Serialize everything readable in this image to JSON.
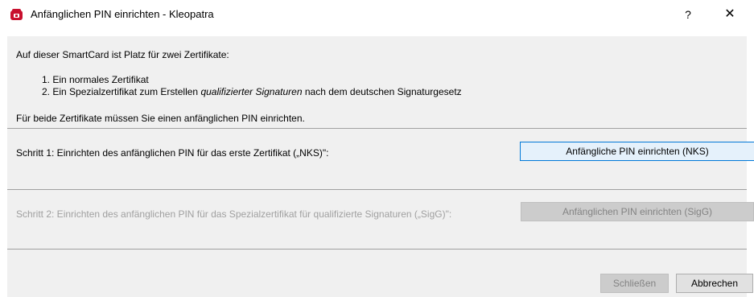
{
  "window": {
    "title": "Anfänglichen PIN einrichten - Kleopatra",
    "help_label": "?",
    "close_label": "✕",
    "app_icon_color": "#c8102e"
  },
  "intro": {
    "text": "Auf dieser SmartCard ist Platz für zwei Zertifikate:",
    "item1": "1. Ein normales Zertifikat",
    "item2_prefix": "2. Ein Spezialzertifikat zum Erstellen",
    "item2_emphasis": "qualifizierter Signaturen",
    "item2_suffix": "nach dem deutschen Signaturgesetz",
    "both_text": "Für beide Zertifikate müssen Sie einen anfänglichen PIN einrichten."
  },
  "step1": {
    "label": "Schritt 1: Einrichten des anfänglichen PIN für das erste Zertifikat („NKS)\":",
    "button": "Anfängliche PIN einrichten (NKS)"
  },
  "step2": {
    "label": "Schritt 2: Einrichten des anfänglichen PIN für das Spezialzertifikat für qualifizierte Signaturen („SigG)\":",
    "button": "Anfänglichen PIN einrichten (SigG)",
    "disabled": true
  },
  "footer": {
    "close_button": "Schließen",
    "close_disabled": true,
    "cancel_button": "Abbrechen"
  }
}
